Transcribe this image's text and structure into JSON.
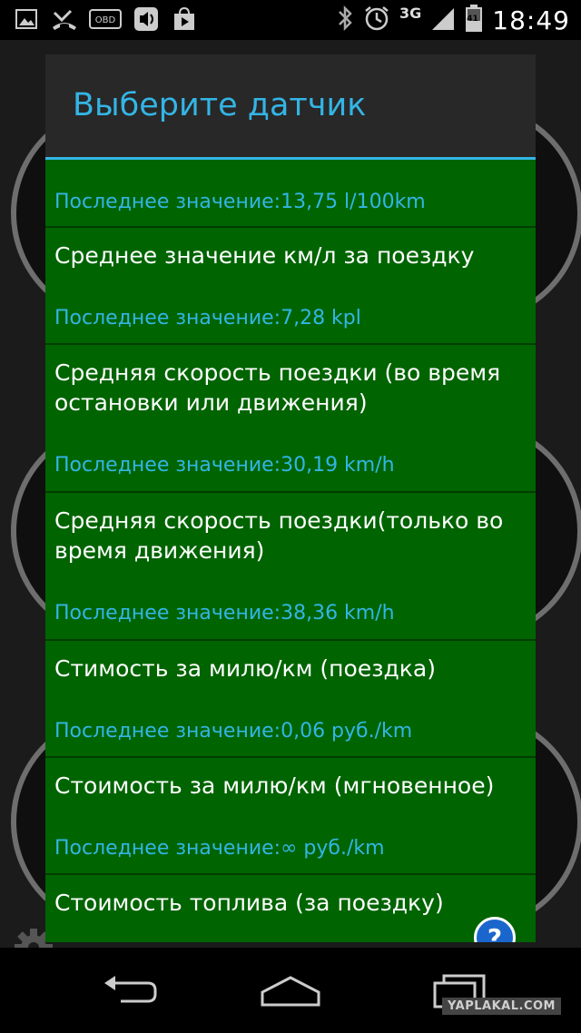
{
  "status_bar": {
    "time": "18:49",
    "network": "3G",
    "battery": "41",
    "left_icons": [
      "image-icon",
      "missed-call-icon",
      "obd-icon",
      "media-icon",
      "shop-icon"
    ],
    "obd_label": "OBD"
  },
  "dialog": {
    "title": "Выберите датчик",
    "items": [
      {
        "name": "",
        "value": "Последнее значение:13,75 l/100km"
      },
      {
        "name": "Среднее значение км/л за поездку",
        "value": "Последнее значение:7,28 kpl"
      },
      {
        "name": "Средняя скорость поездки (во время остановки или движения)",
        "value": "Последнее значение:30,19 km/h"
      },
      {
        "name": "Средняя скорость поездки(только во время движения)",
        "value": "Последнее значение:38,36 km/h"
      },
      {
        "name": "Стимость за милю/км (поездка)",
        "value": "Последнее значение:0,06 руб./km"
      },
      {
        "name": "Стоимость за милю/км (мгновенное)",
        "value": "Последнее значение:∞ руб./km"
      },
      {
        "name": "Стоимость топлива (за поездку)",
        "value": ""
      }
    ],
    "help_label": "?"
  },
  "watermark": "YAPLAKAL.COM",
  "colors": {
    "accent": "#33b5e5",
    "list_bg": "#006400",
    "title_bg": "#282828"
  }
}
